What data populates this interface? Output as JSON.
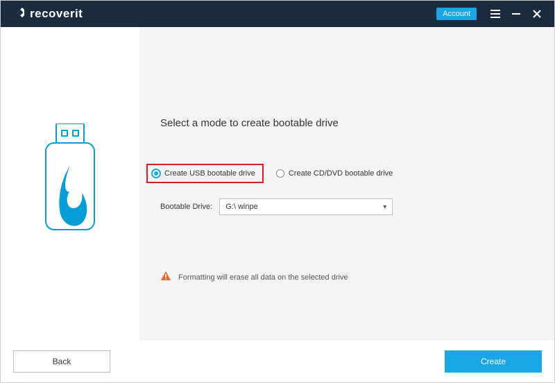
{
  "titlebar": {
    "brand_prefix": "recover",
    "brand_suffix": "it",
    "account_label": "Account"
  },
  "main": {
    "heading": "Select a mode to create bootable drive",
    "options": {
      "usb": {
        "label": "Create USB bootable drive",
        "selected": true
      },
      "cd": {
        "label": "Create CD/DVD bootable drive",
        "selected": false
      }
    },
    "drive_label": "Bootable Drive:",
    "drive_value": "G:\\ winpe",
    "warning": "Formatting will erase all data on the selected drive"
  },
  "footer": {
    "back": "Back",
    "create": "Create"
  }
}
